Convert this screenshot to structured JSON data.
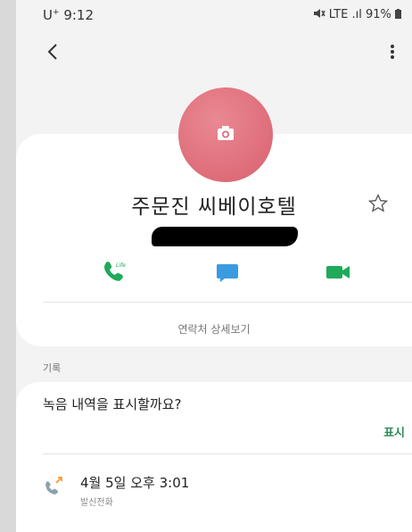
{
  "status_bar": {
    "carrier": "U",
    "carrier_mark": "+",
    "time": "9:12",
    "indicators": "LTE .ıl 91%"
  },
  "contact": {
    "name": "주문진 씨베이호텔",
    "phone_redacted": true,
    "avatar_color": "#e07080",
    "detail_link_label": "연락처 상세보기"
  },
  "actions": {
    "call_badge": "Life",
    "call_color": "#1faa5a",
    "message_color": "#3a9be0",
    "video_color": "#1faa5a"
  },
  "history": {
    "section_label": "기록",
    "prompt": "녹음 내역을 표시할까요?",
    "show_button": "표시",
    "entry": {
      "time": "4월 5일 오후 3:01",
      "type": "발신전화"
    }
  }
}
